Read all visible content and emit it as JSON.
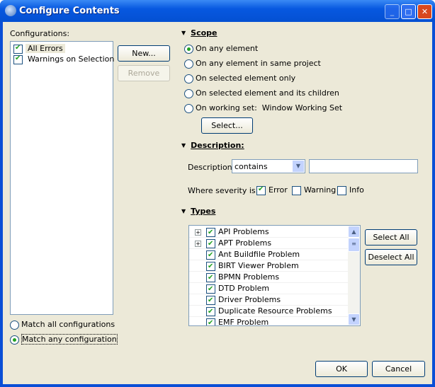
{
  "window": {
    "title": "Configure Contents"
  },
  "configurations": {
    "label": "Configurations:",
    "items": [
      {
        "label": "All Errors",
        "checked": true
      },
      {
        "label": "Warnings on Selection",
        "checked": true
      }
    ],
    "new": "New...",
    "remove": "Remove",
    "match_all": "Match all configurations",
    "match_any": "Match any configuration"
  },
  "scope": {
    "header": "Scope",
    "options": [
      "On any element",
      "On any element in same project",
      "On selected element only",
      "On selected element and its children",
      "On working set:"
    ],
    "working_set": "Window Working Set",
    "select": "Select..."
  },
  "description": {
    "header": "Description:",
    "label": "Description",
    "combo": "contains",
    "text": "",
    "severity_label": "Where severity is:",
    "error": "Error",
    "warning": "Warning",
    "info": "Info"
  },
  "types": {
    "header": "Types",
    "items": [
      {
        "label": "API Problems",
        "expand": true
      },
      {
        "label": "APT Problems",
        "expand": true
      },
      {
        "label": "Ant Buildfile Problem"
      },
      {
        "label": "BIRT Viewer Problem"
      },
      {
        "label": "BPMN Problems"
      },
      {
        "label": "DTD Problem"
      },
      {
        "label": "Driver Problems"
      },
      {
        "label": "Duplicate Resource Problems"
      },
      {
        "label": "EMF Problem"
      }
    ],
    "select_all": "Select All",
    "deselect_all": "Deselect All"
  },
  "footer": {
    "ok": "OK",
    "cancel": "Cancel"
  }
}
